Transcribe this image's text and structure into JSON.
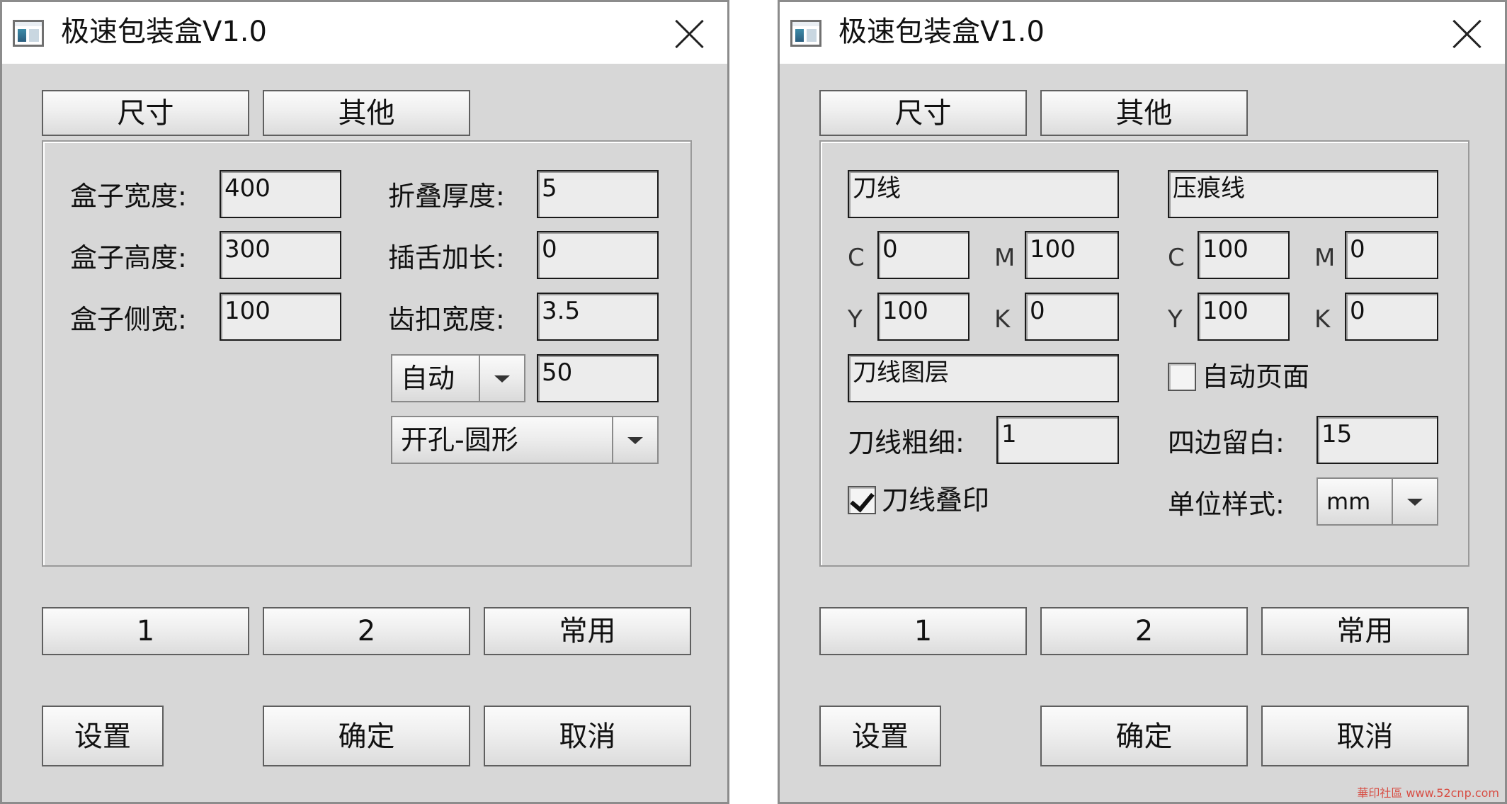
{
  "app_title": "极速包装盒V1.0",
  "tabs": {
    "size": "尺寸",
    "other": "其他"
  },
  "left": {
    "box_width": {
      "label": "盒子宽度:",
      "value": "400"
    },
    "box_height": {
      "label": "盒子高度:",
      "value": "300"
    },
    "box_side": {
      "label": "盒子侧宽:",
      "value": "100"
    },
    "fold_thickness": {
      "label": "折叠厚度:",
      "value": "5"
    },
    "tongue_extend": {
      "label": "插舌加长:",
      "value": "0"
    },
    "buckle_width": {
      "label": "齿扣宽度:",
      "value": "3.5"
    },
    "auto_select": {
      "value": "自动"
    },
    "auto_value": "50",
    "hole_select": {
      "value": "开孔-圆形"
    }
  },
  "right": {
    "cut_line_name": "刀线",
    "crease_line_name": "压痕线",
    "cut_cmyk": {
      "c": "0",
      "m": "100",
      "y": "100",
      "k": "0"
    },
    "crease_cmyk": {
      "c": "100",
      "m": "0",
      "y": "100",
      "k": "0"
    },
    "cmyk_labels": {
      "c": "C",
      "m": "M",
      "y": "Y",
      "k": "K"
    },
    "cut_layer_name": "刀线图层",
    "auto_page": {
      "label": "自动页面",
      "checked": false
    },
    "cut_thickness": {
      "label": "刀线粗细:",
      "value": "1"
    },
    "margin": {
      "label": "四边留白:",
      "value": "15"
    },
    "overprint": {
      "label": "刀线叠印",
      "checked": true
    },
    "unit_style": {
      "label": "单位样式:",
      "value": "mm"
    }
  },
  "bottom_buttons": {
    "b1": "1",
    "b2": "2",
    "common": "常用"
  },
  "actions": {
    "settings": "设置",
    "ok": "确定",
    "cancel": "取消"
  },
  "watermark": "華印社區 www.52cnp.com"
}
